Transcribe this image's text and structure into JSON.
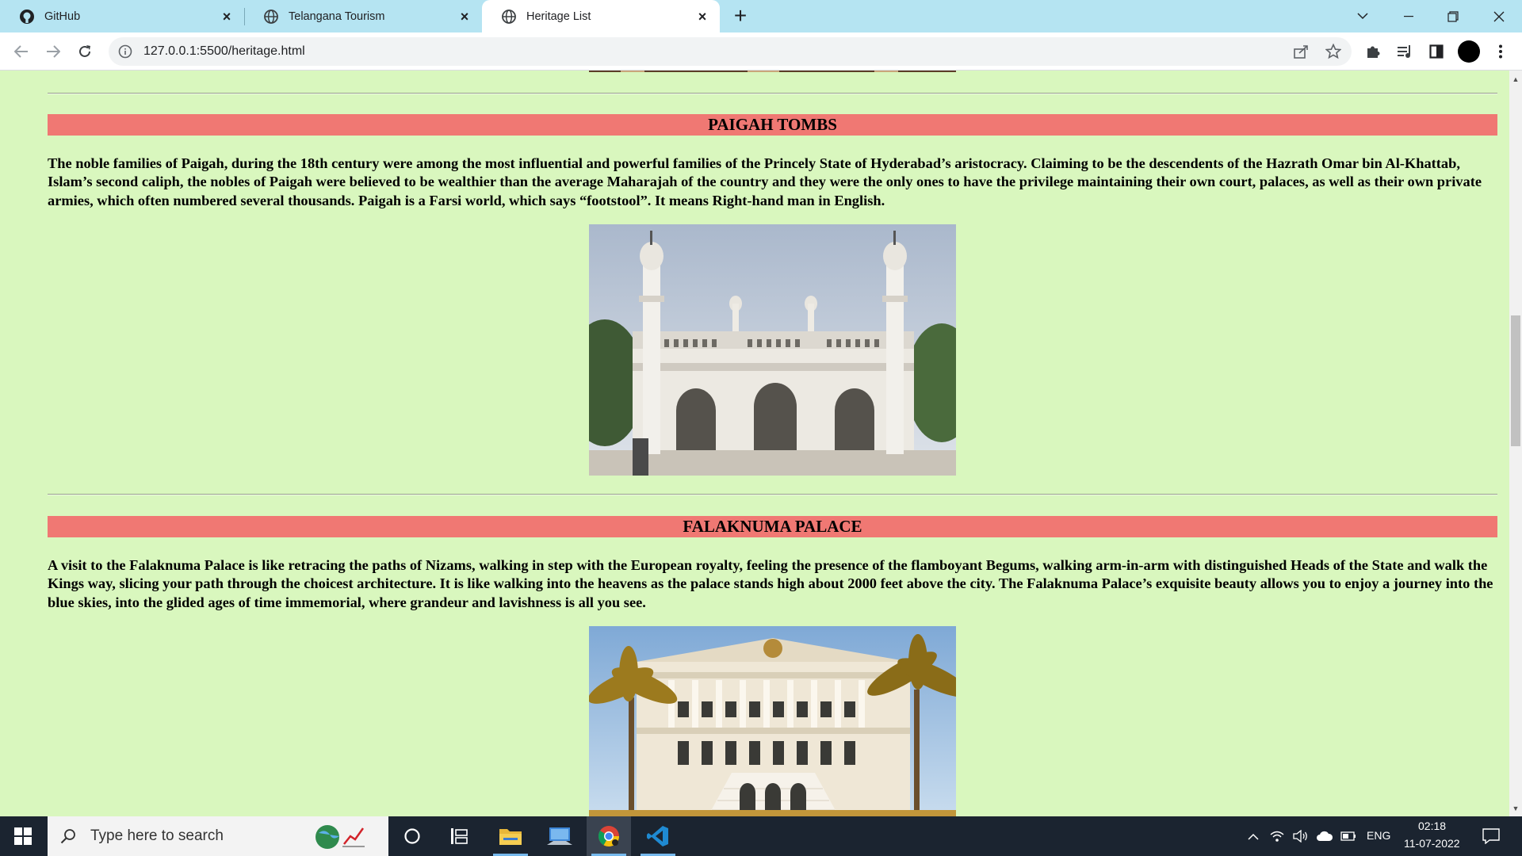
{
  "browser": {
    "tabs": [
      {
        "title": "GitHub",
        "icon": "github-icon",
        "active": false
      },
      {
        "title": "Telangana Tourism",
        "icon": "globe-icon",
        "active": false
      },
      {
        "title": "Heritage List",
        "icon": "globe-icon",
        "active": true
      }
    ],
    "url": "127.0.0.1:5500/heritage.html"
  },
  "page": {
    "background_color": "#d9f7be",
    "heading_color": "#f07873",
    "sections": [
      {
        "title": "PAIGAH TOMBS",
        "text": "The noble families of Paigah, during the 18th century were among the most influential and powerful families of the Princely State of Hyderabad’s aristocracy. Claiming to be the descendents of the Hazrath Omar bin Al-Khattab, Islam’s second caliph, the nobles of Paigah were believed to be wealthier than the average Maharajah of the country and they were the only ones to have the privilege maintaining their own court, palaces, as well as their own private armies, which often numbered several thousands. Paigah is a Farsi world, which says “footstool”. It means Right-hand man in English."
      },
      {
        "title": "FALAKNUMA PALACE",
        "text": "A visit to the Falaknuma Palace is like retracing the paths of Nizams, walking in step with the European royalty, feeling the presence of the flamboyant Begums, walking arm-in-arm with distinguished Heads of the State and walk the Kings way, slicing your path through the choicest architecture. It is like walking into the heavens as the palace stands high about 2000 feet above the city. The Falaknuma Palace’s exquisite beauty allows you to enjoy a journey into the blue skies, into the glided ages of time immemorial, where grandeur and lavishness is all you see."
      }
    ]
  },
  "taskbar": {
    "search_placeholder": "Type here to search",
    "language": "ENG",
    "time": "02:18",
    "date": "11-07-2022"
  }
}
